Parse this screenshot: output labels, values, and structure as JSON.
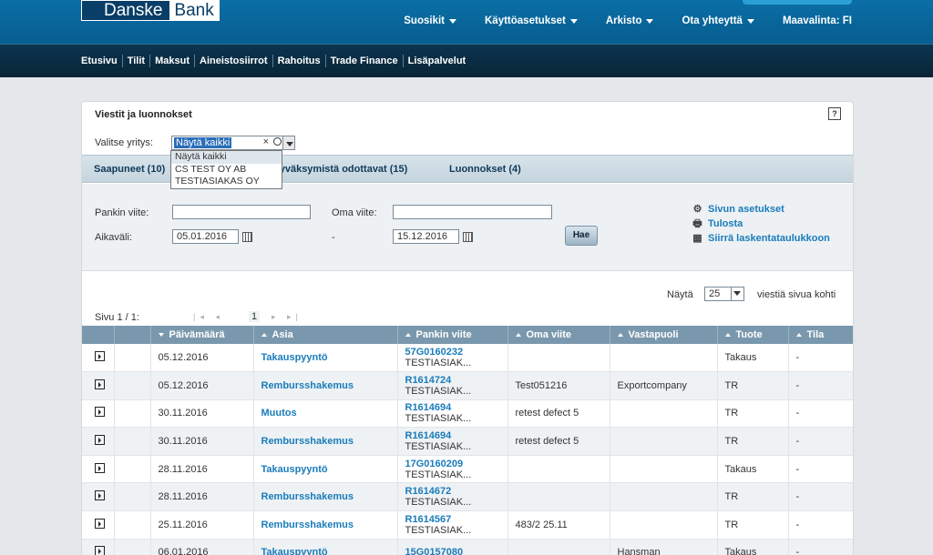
{
  "header": {
    "logo_left": "Danske",
    "logo_right": "Bank",
    "top_nav": [
      "Suosikit",
      "Käyttöasetukset",
      "Arkisto",
      "Ota yhteyttä",
      "Maavalinta: FI"
    ]
  },
  "subnav": [
    "Etusivu",
    "Tilit",
    "Maksut",
    "Aineistosiirrot",
    "Rahoitus",
    "Trade Finance",
    "Lisäpalvelut"
  ],
  "panel": {
    "title": "Viestit ja luonnokset",
    "help_glyph": "?",
    "company_label": "Valitse yritys:",
    "company_value": "Näytä kaikki",
    "clear_glyph": "×",
    "dropdown_options": [
      "Näytä kaikki",
      "CS TEST OY AB",
      "TESTIASIAKAS OY"
    ],
    "tabs": {
      "received": "Saapuneet (10)",
      "approval": "hyväksymistä odottavat (15)",
      "drafts": "Luonnokset (4)"
    }
  },
  "filters": {
    "bank_ref_label": "Pankin viite:",
    "own_ref_label": "Oma viite:",
    "bank_ref_value": "",
    "own_ref_value": "",
    "period_label": "Aikaväli:",
    "date_from": "05.01.2016",
    "dash": "-",
    "date_to": "15.12.2016",
    "search_button": "Hae",
    "links": [
      "Sivun asetukset",
      "Tulosta",
      "Siirrä laskentataulukkoon"
    ]
  },
  "paging": {
    "show_label": "Näytä",
    "per_page": "25",
    "show_suffix": "viestiä sivua kohti",
    "page_info": "Sivu 1 / 1:",
    "first_prev": "|◂ ◂",
    "current_page": "1",
    "next_last": "▸ ▸|"
  },
  "table": {
    "columns": [
      "Päivämäärä",
      "Asia",
      "Pankin viite",
      "Oma viite",
      "Vastapuoli",
      "Tuote",
      "Tila"
    ],
    "rows": [
      {
        "date": "05.12.2016",
        "subject": "Takauspyyntö",
        "bank_ref": "57G0160232",
        "bank_ref_sub": "TESTIASIAK...",
        "own_ref": "",
        "counterparty": "",
        "product": "Takaus",
        "status": "-"
      },
      {
        "date": "05.12.2016",
        "subject": "Rembursshakemus",
        "bank_ref": "R1614724",
        "bank_ref_sub": "TESTIASIAK...",
        "own_ref": "Test051216",
        "counterparty": "Exportcompany",
        "product": "TR",
        "status": "-"
      },
      {
        "date": "30.11.2016",
        "subject": "Muutos",
        "bank_ref": "R1614694",
        "bank_ref_sub": "TESTIASIAK...",
        "own_ref": "retest defect 5",
        "counterparty": "",
        "product": "TR",
        "status": "-"
      },
      {
        "date": "30.11.2016",
        "subject": "Rembursshakemus",
        "bank_ref": "R1614694",
        "bank_ref_sub": "TESTIASIAK...",
        "own_ref": "retest defect 5",
        "counterparty": "",
        "product": "TR",
        "status": "-"
      },
      {
        "date": "28.11.2016",
        "subject": "Takauspyyntö",
        "bank_ref": "17G0160209",
        "bank_ref_sub": "TESTIASIAK...",
        "own_ref": "",
        "counterparty": "",
        "product": "Takaus",
        "status": "-"
      },
      {
        "date": "28.11.2016",
        "subject": "Rembursshakemus",
        "bank_ref": "R1614672",
        "bank_ref_sub": "TESTIASIAK...",
        "own_ref": "",
        "counterparty": "",
        "product": "TR",
        "status": "-"
      },
      {
        "date": "25.11.2016",
        "subject": "Rembursshakemus",
        "bank_ref": "R1614567",
        "bank_ref_sub": "TESTIASIAK...",
        "own_ref": "483/2 25.11",
        "counterparty": "",
        "product": "TR",
        "status": "-"
      },
      {
        "date": "06.01.2016",
        "subject": "Takauspyyntö",
        "bank_ref": "15G0157080",
        "bank_ref_sub": "",
        "own_ref": "",
        "counterparty": "Hansman",
        "product": "Takaus",
        "status": "-"
      }
    ]
  }
}
